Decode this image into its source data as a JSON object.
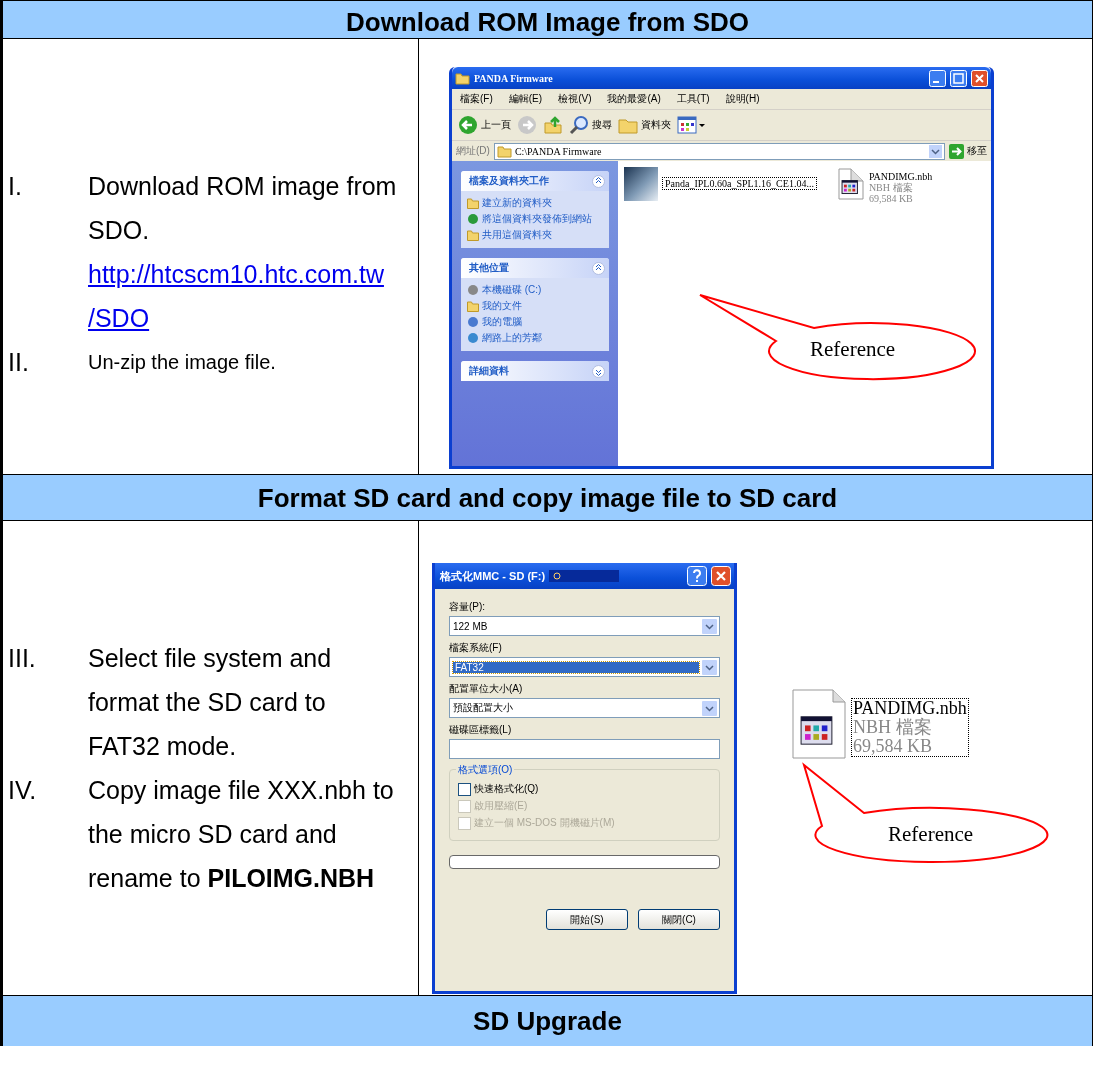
{
  "sections": [
    {
      "heading": "Download ROM Image from SDO",
      "steps": [
        {
          "number": "I.",
          "parts": [
            {
              "kind": "text",
              "text": "Download ROM image from SDO."
            },
            {
              "kind": "link",
              "text": "http://htcscm10.htc.com.tw"
            },
            {
              "kind": "link",
              "text": "/SDO"
            }
          ]
        },
        {
          "number": "II.",
          "parts": [
            {
              "kind": "small",
              "text": "Un-zip the image file."
            }
          ]
        }
      ],
      "figures": [
        {
          "kind": "explorer",
          "title": "PANDA Firmware",
          "menu": [
            "檔案(F)",
            "編輯(E)",
            "檢視(V)",
            "我的最愛(A)",
            "工具(T)",
            "說明(H)"
          ],
          "toolbar": [
            {
              "kind": "back",
              "label": "上一頁"
            },
            {
              "kind": "forward"
            },
            {
              "kind": "up"
            },
            {
              "kind": "search",
              "label": "搜尋"
            },
            {
              "kind": "folders",
              "label": "資料夾"
            },
            {
              "kind": "views"
            }
          ],
          "address_label": "網址(D)",
          "address": "C:\\PANDA Firmware",
          "go": "移至",
          "panels": [
            {
              "title": "檔案及資料夾工作",
              "expanded": true,
              "items": [
                "建立新的資料夾",
                "將這個資料夾發佈到網站",
                "共用這個資料夾"
              ]
            },
            {
              "title": "其他位置",
              "expanded": true,
              "items": [
                "本機磁碟 (C:)",
                "我的文件",
                "我的電腦",
                "網路上的芳鄰"
              ]
            },
            {
              "title": "詳細資料",
              "expanded": false
            }
          ],
          "files": [
            {
              "kind": "image",
              "name": "Panda_IPL0.60a_SPL1.16_CE1.04..."
            },
            {
              "kind": "nbh",
              "name": "PANDIMG.nbh",
              "type": "NBH 檔案",
              "size": "69,584 KB"
            }
          ],
          "callout": "Reference"
        }
      ]
    },
    {
      "heading": "Format SD card and copy image file to SD card",
      "steps": [
        {
          "number": "III.",
          "parts": [
            {
              "kind": "text",
              "text": "Select file system and format the SD card to FAT32 mode."
            }
          ]
        },
        {
          "number": "IV.",
          "parts": [
            {
              "kind": "text",
              "text": "Copy image file XXX.nbh to the micro SD card and rename to **PILOIMG.NBH**"
            }
          ]
        }
      ],
      "figures": [
        {
          "kind": "format_dialog",
          "title": "格式化MMC - SD (F:)",
          "fields": [
            {
              "kind": "select",
              "label": "容量(P):",
              "value": "122 MB",
              "selected": false
            },
            {
              "kind": "select",
              "label": "檔案系統(F)",
              "value": "FAT32",
              "selected": true
            },
            {
              "kind": "select",
              "label": "配置單位大小(A)",
              "value": "預設配置大小",
              "selected": false
            },
            {
              "kind": "text",
              "label": "磁碟區標籤(L)",
              "selected": false
            }
          ],
          "group": "格式選項(O)",
          "options": [
            {
              "label": "快速格式化(Q)",
              "checked": false,
              "disabled": false
            },
            {
              "label": "啟用壓縮(E)",
              "checked": false,
              "disabled": true
            },
            {
              "label": "建立一個 MS-DOS 開機磁片(M)",
              "checked": false,
              "disabled": true
            }
          ],
          "progress": {
            "level": 0
          },
          "buttons": [
            "開始(S)",
            "關閉(C)"
          ]
        },
        {
          "kind": "file_icon",
          "name": "PANDIMG.nbh",
          "type": "NBH 檔案",
          "size": "69,584 KB",
          "callout": "Reference"
        }
      ]
    },
    {
      "heading": "SD Upgrade"
    }
  ]
}
